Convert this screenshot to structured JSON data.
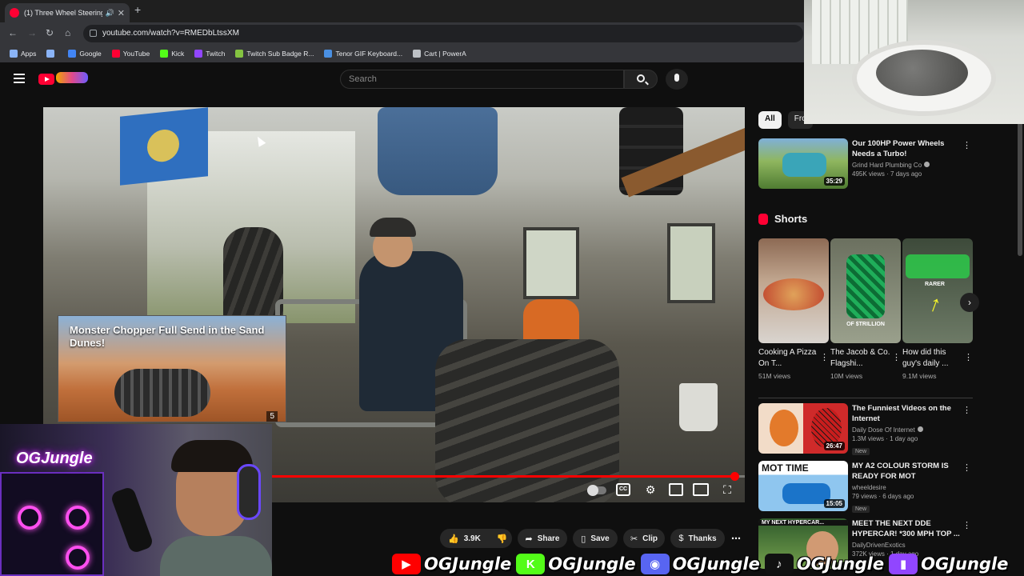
{
  "browser": {
    "tab_title": "(1) Three Wheel Steering F",
    "url": "youtube.com/watch?v=RMEDbLtssXM",
    "bookmarks": [
      {
        "label": "Apps",
        "color": "#8ab4f8"
      },
      {
        "label": "",
        "color": "#8ab4f8"
      },
      {
        "label": "Google",
        "color": "#4285f4"
      },
      {
        "label": "YouTube",
        "color": "#ff0033"
      },
      {
        "label": "Kick",
        "color": "#53fc18"
      },
      {
        "label": "Twitch",
        "color": "#9146ff"
      },
      {
        "label": "Twitch Sub Badge R...",
        "color": "#84c341"
      },
      {
        "label": "Tenor GIF Keyboard...",
        "color": "#4a90e2"
      },
      {
        "label": "Cart | PowerA",
        "color": "#bdc1c6"
      }
    ]
  },
  "header": {
    "search_placeholder": "Search"
  },
  "player": {
    "progress": 0.985,
    "endcard_title": "Monster Chopper Full Send in the Sand Dunes!",
    "endcard_number": "5"
  },
  "actions": {
    "likes": "3.9K",
    "share": "Share",
    "save": "Save",
    "clip": "Clip",
    "thanks": "Thanks"
  },
  "sidebar": {
    "chips": [
      "All",
      "Fro"
    ],
    "top_video": {
      "title": "Our 100HP Power Wheels Needs a Turbo!",
      "channel": "Grind Hard Plumbing Co",
      "meta": "495K views · 7 days ago",
      "duration": "35:29",
      "verified": true
    },
    "shorts_title": "Shorts",
    "shorts": [
      {
        "title": "Cooking A Pizza On T...",
        "views": "51M views"
      },
      {
        "title": "The Jacob & Co. Flagshi...",
        "views": "10M views"
      },
      {
        "title": "How did this guy's daily ...",
        "views": "9.1M views"
      }
    ],
    "videos": [
      {
        "title": "The Funniest Videos on the Internet",
        "channel": "Daily Dose Of Internet",
        "meta": "1.3M views · 1 day ago",
        "duration": "26:47",
        "badge": "New",
        "verified": true
      },
      {
        "title": "MY A2 COLOUR STORM IS READY FOR MOT",
        "channel": "wheeldesire",
        "meta": "79 views · 6 days ago",
        "duration": "15:05",
        "badge": "New",
        "verified": false
      },
      {
        "title": "MEET THE NEXT DDE HYPERCAR! *300 MPH TOP ...",
        "channel": "DailyDrivenExotics",
        "meta": "372K views · 1 day ago",
        "duration": "",
        "badge": "",
        "verified": true
      }
    ],
    "thumb_labels": {
      "short2": "OF $TRILLION",
      "short3": "RARER",
      "vid2": "MOT TIME",
      "vid3": "MY NEXT HYPERCAR..."
    }
  },
  "overlay": {
    "neon_text": "OGJungle",
    "social": [
      {
        "platform": "youtube-icon",
        "handle": "OGJungle",
        "color": "#ff0000",
        "glyph": "▶"
      },
      {
        "platform": "kick-icon",
        "handle": "OGJungle",
        "color": "#53fc18",
        "glyph": "K"
      },
      {
        "platform": "discord-icon",
        "handle": "OGJungle",
        "color": "#5865f2",
        "glyph": "◉"
      },
      {
        "platform": "tiktok-icon",
        "handle": "OGJungle",
        "color": "#111111",
        "glyph": "♪"
      },
      {
        "platform": "twitch-icon",
        "handle": "OGJungle",
        "color": "#9146ff",
        "glyph": "▮"
      }
    ]
  }
}
